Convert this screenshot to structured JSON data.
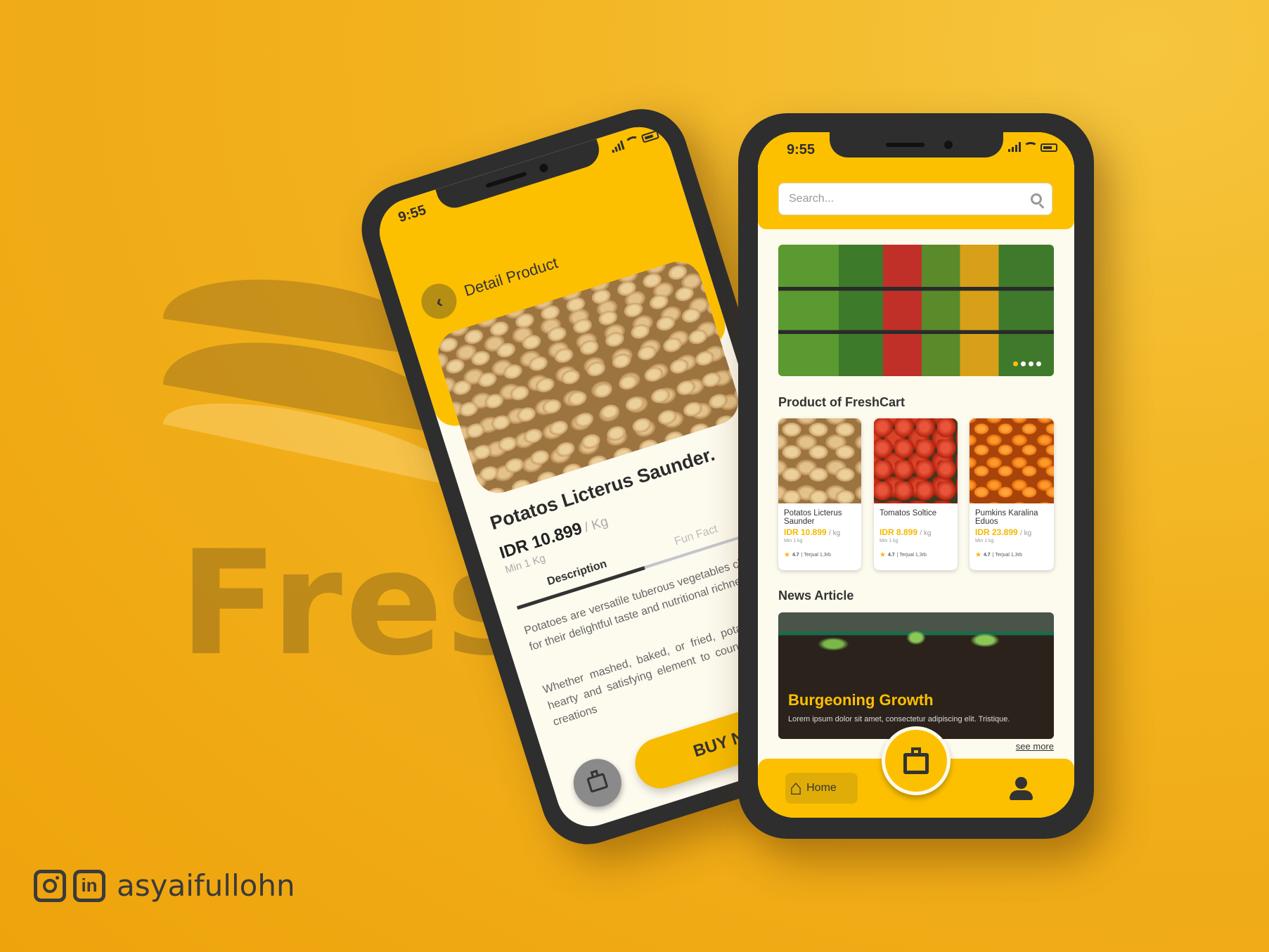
{
  "background": {
    "brand_color": "#f2b21e",
    "watermark_text": "Fresh"
  },
  "credit": {
    "instagram_icon": "instagram-icon",
    "linkedin_icon": "linkedin-icon",
    "linkedin_glyph": "in",
    "handle": "asyaifullohn"
  },
  "detail_screen": {
    "status": {
      "time": "9:55"
    },
    "header": {
      "title": "Detail Product",
      "back_icon": "chevron-left-icon"
    },
    "product": {
      "name": "Potatos Licterus Saunder.",
      "price": "IDR 10.899",
      "unit": "/ Kg",
      "min": "Min 1 Kg"
    },
    "tabs": [
      {
        "label": "Description",
        "active": true
      },
      {
        "label": "Fun Fact",
        "active": false
      }
    ],
    "description": [
      "Potatoes are versatile tuberous vegetables cherished for their delightful taste and nutritional richness.",
      "Whether mashed, baked, or fried, potatoes add a hearty and satisfying element to countless culinary creations"
    ],
    "buy_now": "BUY NOW",
    "bag_icon": "shopping-bag-icon"
  },
  "home_screen": {
    "status": {
      "time": "9:55"
    },
    "search": {
      "placeholder": "Search...",
      "icon": "search-icon"
    },
    "banner": {
      "dots": 4,
      "active_dot": 1
    },
    "products_title": "Product of FreshCart",
    "products": [
      {
        "name": "Potatos Licterus Saunder",
        "price": "IDR 10.899",
        "unit": "/ kg",
        "min": "Min 1 kg",
        "rating": "4.7",
        "sold": "| Terjual 1,3rb"
      },
      {
        "name": "Tomatos Soltice",
        "price": "IDR 8.899",
        "unit": "/ kg",
        "min": "Min 1 kg",
        "rating": "4.7",
        "sold": "| Terjual 1,3rb"
      },
      {
        "name": "Pumkins Karalina Eduos",
        "price": "IDR 23.899",
        "unit": "/ kg",
        "min": "Min 1 kg",
        "rating": "4.7",
        "sold": "| Terjual 1,3rb"
      }
    ],
    "news_title": "News Article",
    "news": {
      "headline": "Burgeoning Growth",
      "summary": "Lorem ipsum dolor sit amet, consectetur adipiscing elit. Tristique.",
      "see_more": "see more"
    },
    "nav": {
      "home": "Home",
      "home_icon": "home-icon",
      "cart_icon": "shopping-bag-icon",
      "profile_icon": "user-icon"
    }
  }
}
